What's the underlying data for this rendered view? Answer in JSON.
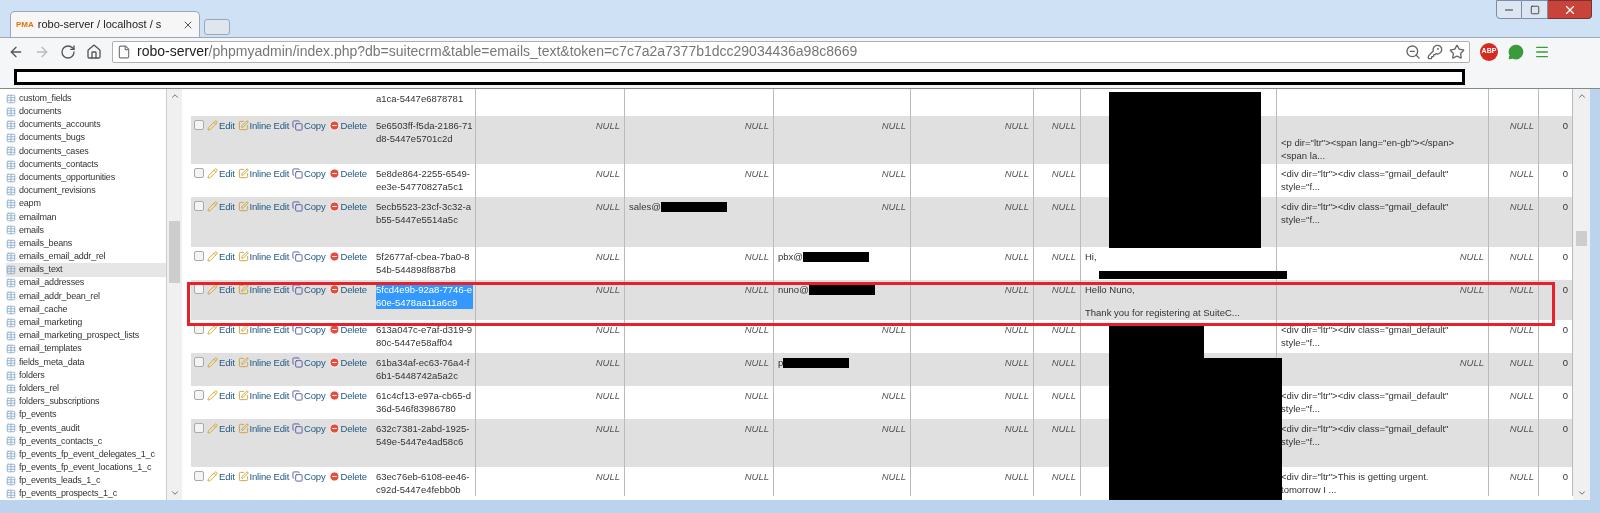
{
  "window": {
    "tab_title": "robo-server / localhost / s",
    "app_badge": "PMA",
    "url_host": "robo-server",
    "url_path": "/phpmyadmin/index.php?db=suitecrm&table=emails_text&token=c7c7a2a7377b1dcc29034436a98c8669",
    "extension_badge": "ABP"
  },
  "sidebar": {
    "tables": [
      {
        "name": "custom_fields",
        "selected": false
      },
      {
        "name": "documents",
        "selected": false
      },
      {
        "name": "documents_accounts",
        "selected": false
      },
      {
        "name": "documents_bugs",
        "selected": false
      },
      {
        "name": "documents_cases",
        "selected": false
      },
      {
        "name": "documents_contacts",
        "selected": false
      },
      {
        "name": "documents_opportunities",
        "selected": false
      },
      {
        "name": "document_revisions",
        "selected": false
      },
      {
        "name": "eapm",
        "selected": false
      },
      {
        "name": "emailman",
        "selected": false
      },
      {
        "name": "emails",
        "selected": false
      },
      {
        "name": "emails_beans",
        "selected": false
      },
      {
        "name": "emails_email_addr_rel",
        "selected": false
      },
      {
        "name": "emails_text",
        "selected": true
      },
      {
        "name": "email_addresses",
        "selected": false
      },
      {
        "name": "email_addr_bean_rel",
        "selected": false
      },
      {
        "name": "email_cache",
        "selected": false
      },
      {
        "name": "email_marketing",
        "selected": false
      },
      {
        "name": "email_marketing_prospect_lists",
        "selected": false
      },
      {
        "name": "email_templates",
        "selected": false
      },
      {
        "name": "fields_meta_data",
        "selected": false
      },
      {
        "name": "folders",
        "selected": false
      },
      {
        "name": "folders_rel",
        "selected": false
      },
      {
        "name": "folders_subscriptions",
        "selected": false
      },
      {
        "name": "fp_events",
        "selected": false
      },
      {
        "name": "fp_events_audit",
        "selected": false
      },
      {
        "name": "fp_events_contacts_c",
        "selected": false
      },
      {
        "name": "fp_events_fp_event_delegates_1_c",
        "selected": false
      },
      {
        "name": "fp_events_fp_event_locations_1_c",
        "selected": false
      },
      {
        "name": "fp_events_leads_1_c",
        "selected": false
      },
      {
        "name": "fp_events_prospects_1_c",
        "selected": false
      }
    ]
  },
  "table": {
    "rows": [
      {
        "id": "a1ca-5447e6878781",
        "highlighted": false,
        "cells": [
          {
            "kind": "empty"
          },
          {
            "kind": "empty"
          },
          {
            "kind": "empty"
          },
          {
            "kind": "empty"
          },
          {
            "kind": "empty"
          },
          {
            "kind": "empty"
          },
          {
            "kind": "empty"
          },
          {
            "kind": "empty"
          },
          {
            "kind": "empty"
          }
        ]
      },
      {
        "checked": false,
        "actions": [
          "Edit",
          "Inline Edit",
          "Copy",
          "Delete"
        ],
        "id": "5e6503ff-f5da-2186-71d8-5447e5701c2d",
        "highlighted": false,
        "cells": [
          {
            "kind": "null",
            "text": "NULL"
          },
          {
            "kind": "null",
            "text": "NULL"
          },
          {
            "kind": "null",
            "text": "NULL"
          },
          {
            "kind": "null",
            "text": "NULL"
          },
          {
            "kind": "null",
            "text": "NULL"
          },
          {
            "kind": "empty"
          },
          {
            "kind": "text",
            "bottom": true,
            "lines": [
              "<p dir=\"ltr\"><span lang=\"en-gb\"></span>",
              "<span la..."
            ]
          },
          {
            "kind": "null",
            "text": "NULL"
          },
          {
            "kind": "number",
            "text": "0"
          }
        ]
      },
      {
        "checked": false,
        "actions": [
          "Edit",
          "Inline Edit",
          "Copy",
          "Delete"
        ],
        "id": "5e8de864-2255-6549-ee3e-54770827a5c1",
        "highlighted": false,
        "cells": [
          {
            "kind": "null",
            "text": "NULL"
          },
          {
            "kind": "null",
            "text": "NULL"
          },
          {
            "kind": "null",
            "text": "NULL"
          },
          {
            "kind": "null",
            "text": "NULL"
          },
          {
            "kind": "null",
            "text": "NULL"
          },
          {
            "kind": "empty"
          },
          {
            "kind": "text",
            "lines": [
              "<div dir=\"ltr\"><div class=\"gmail_default\"",
              "style=\"f..."
            ]
          },
          {
            "kind": "null",
            "text": "NULL"
          },
          {
            "kind": "number",
            "text": "0"
          }
        ]
      },
      {
        "checked": false,
        "actions": [
          "Edit",
          "Inline Edit",
          "Copy",
          "Delete"
        ],
        "id": "5ecb5523-23cf-3c32-ab55-5447e5514a5c",
        "highlighted": false,
        "cells": [
          {
            "kind": "null",
            "text": "NULL"
          },
          {
            "kind": "email",
            "text": "sales@"
          },
          {
            "kind": "null",
            "text": "NULL"
          },
          {
            "kind": "null",
            "text": "NULL"
          },
          {
            "kind": "null",
            "text": "NULL"
          },
          {
            "kind": "empty"
          },
          {
            "kind": "text",
            "lines": [
              "<div dir=\"ltr\"><div class=\"gmail_default\"",
              "style=\"f..."
            ]
          },
          {
            "kind": "null",
            "text": "NULL"
          },
          {
            "kind": "number",
            "text": "0"
          }
        ]
      },
      {
        "checked": false,
        "actions": [
          "Edit",
          "Inline Edit",
          "Copy",
          "Delete"
        ],
        "id": "5f2677af-cbea-7ba0-854b-544898f887b8",
        "highlighted": false,
        "cells": [
          {
            "kind": "null",
            "text": "NULL"
          },
          {
            "kind": "null",
            "text": "NULL"
          },
          {
            "kind": "email",
            "text": "pbx@"
          },
          {
            "kind": "null",
            "text": "NULL"
          },
          {
            "kind": "null",
            "text": "NULL"
          },
          {
            "kind": "text",
            "lines": [
              "Hi,"
            ]
          },
          {
            "kind": "null",
            "text": "NULL"
          },
          {
            "kind": "null",
            "text": "NULL"
          },
          {
            "kind": "number",
            "text": "0"
          }
        ]
      },
      {
        "checked": false,
        "actions": [
          "Edit",
          "Inline Edit",
          "Copy",
          "Delete"
        ],
        "id": "5fcd4e9b-92a8-7746-e60e-5478aa11a6c9",
        "highlighted": true,
        "cells": [
          {
            "kind": "null",
            "text": "NULL"
          },
          {
            "kind": "null",
            "text": "NULL"
          },
          {
            "kind": "email",
            "text": "nuno@"
          },
          {
            "kind": "null",
            "text": "NULL"
          },
          {
            "kind": "null",
            "text": "NULL"
          },
          {
            "kind": "text",
            "paragraphs": [
              "Hello Nuno,",
              "Thank you for registering at SuiteC..."
            ]
          },
          {
            "kind": "null",
            "text": "NULL"
          },
          {
            "kind": "null",
            "text": "NULL"
          },
          {
            "kind": "number",
            "text": "0"
          }
        ]
      },
      {
        "checked": false,
        "actions": [
          "Edit",
          "Inline Edit",
          "Copy",
          "Delete"
        ],
        "id": "613a047c-e7af-d319-980c-5447e58aff04",
        "highlighted": false,
        "cells": [
          {
            "kind": "null",
            "text": "NULL"
          },
          {
            "kind": "null",
            "text": "NULL"
          },
          {
            "kind": "null",
            "text": "NULL"
          },
          {
            "kind": "null",
            "text": "NULL"
          },
          {
            "kind": "null",
            "text": "NULL"
          },
          {
            "kind": "empty"
          },
          {
            "kind": "text",
            "lines": [
              "<div dir=\"ltr\"><div class=\"gmail_default\"",
              "style=\"f..."
            ]
          },
          {
            "kind": "null",
            "text": "NULL"
          },
          {
            "kind": "number",
            "text": "0"
          }
        ]
      },
      {
        "checked": false,
        "actions": [
          "Edit",
          "Inline Edit",
          "Copy",
          "Delete"
        ],
        "id": "61ba34af-ec63-76a4-f6b1-5448742a5a2c",
        "highlighted": false,
        "cells": [
          {
            "kind": "null",
            "text": "NULL"
          },
          {
            "kind": "null",
            "text": "NULL"
          },
          {
            "kind": "email",
            "text": "p"
          },
          {
            "kind": "null",
            "text": "NULL"
          },
          {
            "kind": "null",
            "text": "NULL"
          },
          {
            "kind": "empty"
          },
          {
            "kind": "null",
            "text": "NULL"
          },
          {
            "kind": "null",
            "text": "NULL"
          },
          {
            "kind": "number",
            "text": "0"
          }
        ]
      },
      {
        "checked": false,
        "actions": [
          "Edit",
          "Inline Edit",
          "Copy",
          "Delete"
        ],
        "id": "61c4cf13-e97a-cb65-d36d-546f83986780",
        "highlighted": false,
        "cells": [
          {
            "kind": "null",
            "text": "NULL"
          },
          {
            "kind": "null",
            "text": "NULL"
          },
          {
            "kind": "null",
            "text": "NULL"
          },
          {
            "kind": "null",
            "text": "NULL"
          },
          {
            "kind": "null",
            "text": "NULL"
          },
          {
            "kind": "empty"
          },
          {
            "kind": "text",
            "lines": [
              "<div dir=\"ltr\"><div class=\"gmail_default\"",
              "style=\"f..."
            ]
          },
          {
            "kind": "null",
            "text": "NULL"
          },
          {
            "kind": "number",
            "text": "0"
          }
        ]
      },
      {
        "checked": false,
        "actions": [
          "Edit",
          "Inline Edit",
          "Copy",
          "Delete"
        ],
        "id": "632c7381-2abd-1925-549e-5447e4ad58c6",
        "highlighted": false,
        "cells": [
          {
            "kind": "null",
            "text": "NULL"
          },
          {
            "kind": "null",
            "text": "NULL"
          },
          {
            "kind": "null",
            "text": "NULL"
          },
          {
            "kind": "null",
            "text": "NULL"
          },
          {
            "kind": "null",
            "text": "NULL"
          },
          {
            "kind": "empty"
          },
          {
            "kind": "text",
            "lines": [
              "<div dir=\"ltr\"><div class=\"gmail_default\"",
              "style=\"f..."
            ]
          },
          {
            "kind": "null",
            "text": "NULL"
          },
          {
            "kind": "number",
            "text": "0"
          }
        ]
      },
      {
        "checked": false,
        "actions": [
          "Edit",
          "Inline Edit",
          "Copy",
          "Delete"
        ],
        "id": "63ec76eb-6108-ee46-c92d-5447e4febb0b",
        "highlighted": false,
        "cells": [
          {
            "kind": "null",
            "text": "NULL"
          },
          {
            "kind": "null",
            "text": "NULL"
          },
          {
            "kind": "null",
            "text": "NULL"
          },
          {
            "kind": "null",
            "text": "NULL"
          },
          {
            "kind": "null",
            "text": "NULL"
          },
          {
            "kind": "empty"
          },
          {
            "kind": "text",
            "lines": [
              "<div dir=\"ltr\">This is getting urgent.",
              "tomorrow I ..."
            ]
          },
          {
            "kind": "null",
            "text": "NULL"
          },
          {
            "kind": "number",
            "text": "0"
          }
        ]
      }
    ]
  }
}
